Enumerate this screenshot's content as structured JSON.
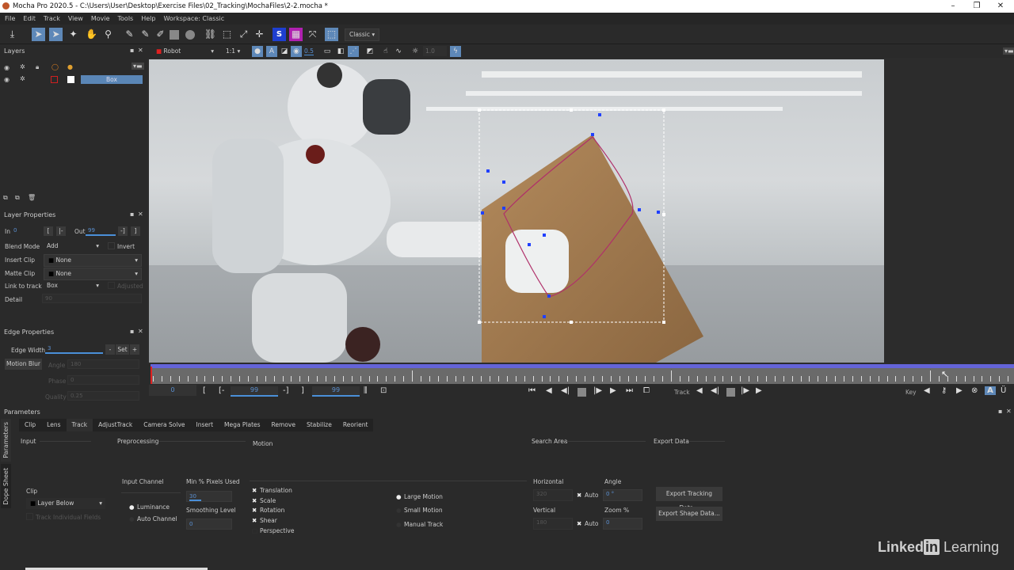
{
  "window": {
    "title": "Mocha Pro 2020.5 - C:\\Users\\User\\Desktop\\Exercise Files\\02_Tracking\\MochaFiles\\2-2.mocha *"
  },
  "menu": [
    "File",
    "Edit",
    "Track",
    "View",
    "Movie",
    "Tools",
    "Help",
    "Workspace: Classic"
  ],
  "toolbar": {
    "workspace": "Classic",
    "layer_select": "Robot",
    "zoom": "1:1",
    "opacity": "0.5",
    "value": "1.0"
  },
  "layers": {
    "title": "Layers",
    "items": [
      {
        "name": "Box",
        "color": "#cc2222"
      }
    ]
  },
  "layer_properties": {
    "title": "Layer Properties",
    "in_label": "In",
    "in": "0",
    "out_label": "Out",
    "out": "99",
    "blend_label": "Blend Mode",
    "blend": "Add",
    "invert": "Invert",
    "insert_label": "Insert Clip",
    "insert": "None",
    "matte_label": "Matte Clip",
    "matte": "None",
    "link_label": "Link to track",
    "link": "Box",
    "adjusted": "Adjusted",
    "detail_label": "Detail",
    "detail": "90"
  },
  "edge_properties": {
    "title": "Edge Properties",
    "width_label": "Edge Width",
    "width": "3",
    "minus": "-",
    "set": "Set",
    "plus": "+",
    "motion_blur": "Motion Blur",
    "angle_label": "Angle",
    "angle": "180",
    "phase_label": "Phase",
    "phase": "0",
    "quality_label": "Quality",
    "quality": "0.25"
  },
  "timeline": {
    "current": "0",
    "in": "99",
    "out": "99",
    "track_label": "Track",
    "key_label": "Key"
  },
  "parameters": {
    "title": "Parameters",
    "side_tabs": [
      "Parameters",
      "Dope Sheet"
    ],
    "tabs": [
      "Clip",
      "Lens",
      "Track",
      "AdjustTrack",
      "Camera Solve",
      "Insert",
      "Mega Plates",
      "Remove",
      "Stabilize",
      "Reorient"
    ],
    "active_tab": "Track",
    "input": {
      "title": "Input",
      "clip_label": "Clip",
      "clip": "Layer Below",
      "track_fields": "Track Individual Fields"
    },
    "preprocessing": {
      "title": "Preprocessing",
      "channel_label": "Input Channel",
      "luminance": "Luminance",
      "auto_channel": "Auto Channel",
      "min_pixels_label": "Min % Pixels Used",
      "min_pixels": "30",
      "smoothing_label": "Smoothing Level",
      "smoothing": "0"
    },
    "motion": {
      "title": "Motion",
      "options": [
        {
          "label": "Translation",
          "checked": true
        },
        {
          "label": "Scale",
          "checked": true
        },
        {
          "label": "Rotation",
          "checked": true
        },
        {
          "label": "Shear",
          "checked": true
        },
        {
          "label": "Perspective",
          "checked": false
        }
      ],
      "large": "Large Motion",
      "small": "Small Motion",
      "manual": "Manual Track"
    },
    "search_area": {
      "title": "Search Area",
      "horizontal_label": "Horizontal",
      "horizontal": "320",
      "vertical_label": "Vertical",
      "vertical": "180",
      "auto": "Auto",
      "angle_label": "Angle",
      "angle": "0 °",
      "zoom_label": "Zoom %",
      "zoom": "0"
    },
    "export": {
      "title": "Export Data",
      "tracking": "Export Tracking Data...",
      "shape": "Export Shape Data..."
    }
  },
  "watermark": "LinkedIn Learning"
}
